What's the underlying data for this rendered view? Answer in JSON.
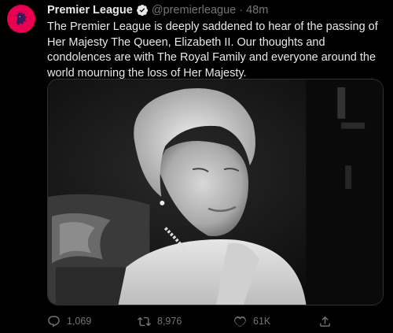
{
  "tweet": {
    "display_name": "Premier League",
    "handle": "@premierleague",
    "separator": "·",
    "time": "48m",
    "text": "The Premier League is deeply saddened to hear of the passing of Her Majesty The Queen, Elizabeth II. Our thoughts and condolences are with The Royal Family and everyone around the world mourning the loss of Her Majesty."
  },
  "actions": {
    "reply_count": "1,069",
    "retweet_count": "8,976",
    "like_count": "61K"
  },
  "icons": {
    "avatar": "premier-league-lion-icon",
    "verified": "verified-badge-icon",
    "reply": "reply-icon",
    "retweet": "retweet-icon",
    "like": "heart-icon",
    "share": "share-icon"
  },
  "colors": {
    "background": "#000000",
    "avatar_bg": "#e90052",
    "text": "#e7e9ea",
    "muted": "#71767b"
  }
}
